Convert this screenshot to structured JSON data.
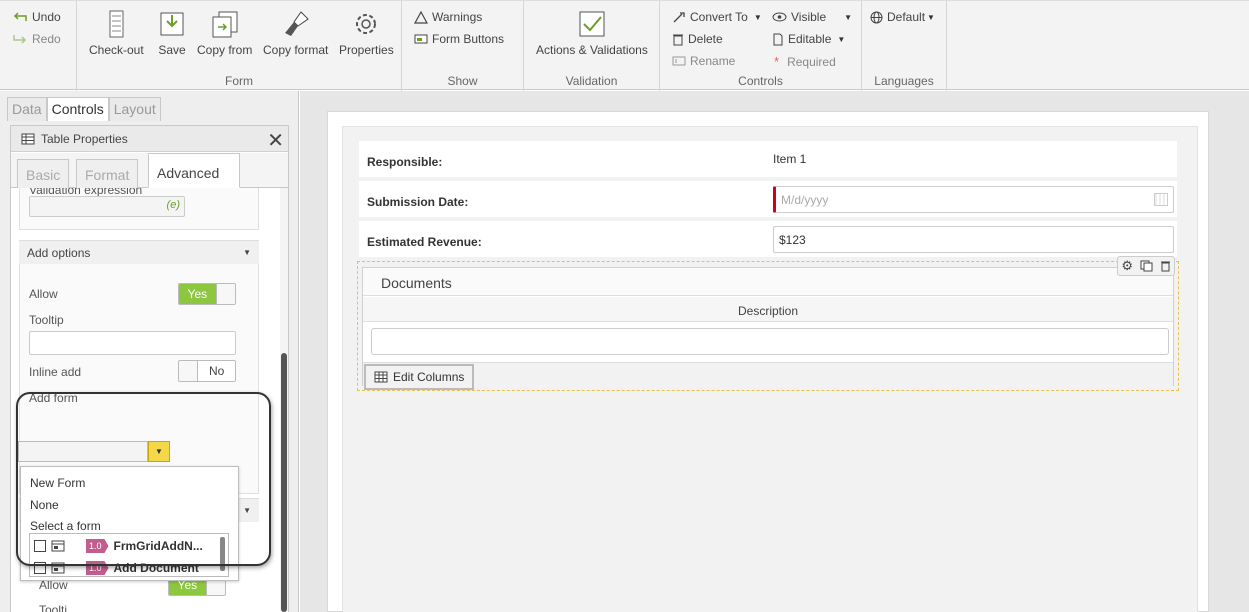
{
  "ribbon": {
    "undo": "Undo",
    "redo": "Redo",
    "form_group": {
      "label": "Form",
      "checkout": "Check-out",
      "save": "Save",
      "copy_from": "Copy from",
      "copy_format": "Copy format",
      "properties": "Properties"
    },
    "show_group": {
      "label": "Show",
      "warnings": "Warnings",
      "form_buttons": "Form Buttons"
    },
    "validation_group": {
      "label": "Validation",
      "actions": "Actions & Validations"
    },
    "controls_group": {
      "label": "Controls",
      "convert_to": "Convert To",
      "delete": "Delete",
      "rename": "Rename",
      "visible": "Visible",
      "editable": "Editable",
      "required": "Required"
    },
    "languages_group": {
      "label": "Languages",
      "default": "Default"
    }
  },
  "panel_tabs": [
    "Data",
    "Controls",
    "Layout"
  ],
  "props": {
    "title": "Table Properties",
    "tabs": [
      "Basic",
      "Format",
      "Advanced"
    ],
    "validation_expression_label": "Validation expression",
    "add_options": {
      "title": "Add options",
      "allow_label": "Allow",
      "allow_value": "Yes",
      "tooltip_label": "Tooltip",
      "inline_add_label": "Inline add",
      "inline_add_value": "No",
      "add_form_label": "Add form"
    },
    "dropdown": {
      "items": [
        "New Form",
        "None",
        "Select a form"
      ],
      "forms": [
        {
          "version": "1.0",
          "name": "FrmGridAddN..."
        },
        {
          "version": "1.0",
          "name": "Add Document"
        }
      ]
    },
    "lower_allow_label": "Allow",
    "lower_allow_value": "Yes",
    "lower_tooltip_label": "Toolti"
  },
  "form": {
    "rows": [
      {
        "label": "Responsible:",
        "value": "Item 1"
      },
      {
        "label": "Submission Date:",
        "placeholder": "M/d/yyyy"
      },
      {
        "label": "Estimated Revenue:",
        "value": "$123"
      }
    ],
    "documents": {
      "title": "Documents",
      "column": "Description",
      "edit_columns": "Edit Columns"
    }
  },
  "colors": {
    "toggle_on": "#8dc63f",
    "required_marker": "#d0021b",
    "version_badge": "#c25e8e",
    "dropdown_arrow": "#f5d84a"
  }
}
